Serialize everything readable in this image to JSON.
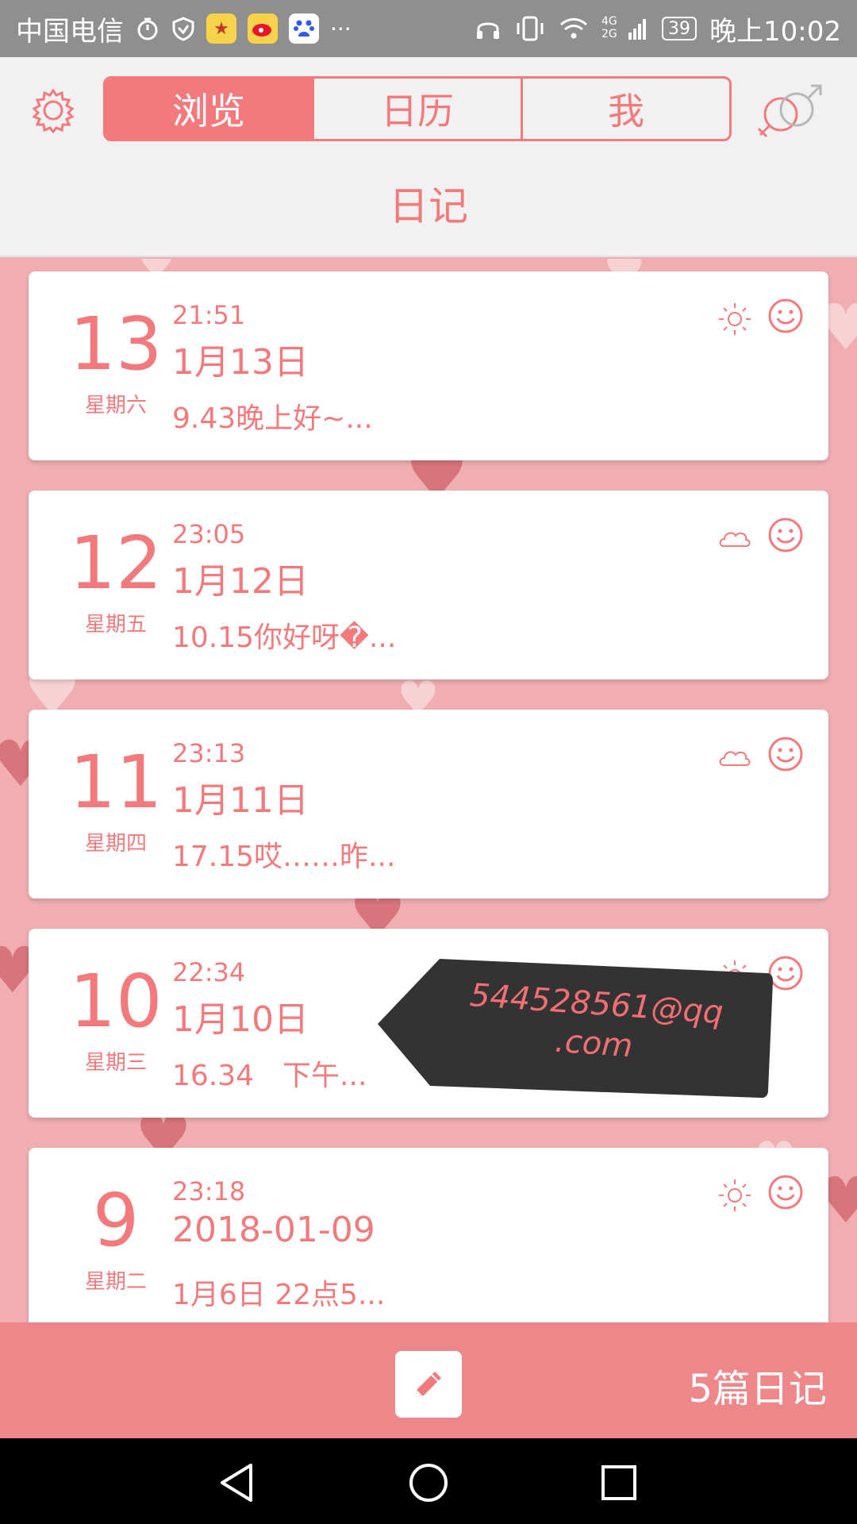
{
  "status_bar": {
    "carrier": "中国电信",
    "overflow": "···",
    "battery": "39",
    "time": "晚上10:02",
    "network_labels": [
      "4G",
      "2G"
    ]
  },
  "header": {
    "tabs": [
      {
        "label": "浏览",
        "active": true
      },
      {
        "label": "日历",
        "active": false
      },
      {
        "label": "我",
        "active": false
      }
    ],
    "title": "日记"
  },
  "entries": [
    {
      "day": "13",
      "weekday": "星期六",
      "time": "21:51",
      "title": "1月13日",
      "excerpt": "9.43晚上好~...",
      "weather": "sun-icon",
      "mood": "smiley-icon"
    },
    {
      "day": "12",
      "weekday": "星期五",
      "time": "23:05",
      "title": "1月12日",
      "excerpt": "10.15你好呀�...",
      "weather": "cloud-icon",
      "mood": "smiley-icon"
    },
    {
      "day": "11",
      "weekday": "星期四",
      "time": "23:13",
      "title": "1月11日",
      "excerpt": "17.15哎……昨...",
      "weather": "cloud-icon",
      "mood": "smiley-icon"
    },
    {
      "day": "10",
      "weekday": "星期三",
      "time": "22:34",
      "title": "1月10日",
      "excerpt": "16.34　下午...",
      "weather": "sun-icon",
      "mood": "smiley-icon"
    },
    {
      "day": "9",
      "weekday": "星期二",
      "time": "23:18",
      "title": "2018-01-09",
      "excerpt": "1月6日 22点5...",
      "weather": "sun-icon",
      "mood": "smiley-icon"
    }
  ],
  "watermark": {
    "line1": "544528561@qq",
    "line2": ".com"
  },
  "bottom_bar": {
    "count_label": "5篇日记"
  },
  "colors": {
    "accent": "#f27a7d",
    "background": "#f0aeb1",
    "bottom_bar": "#ee8789",
    "status_bar": "#8f8f8f"
  }
}
